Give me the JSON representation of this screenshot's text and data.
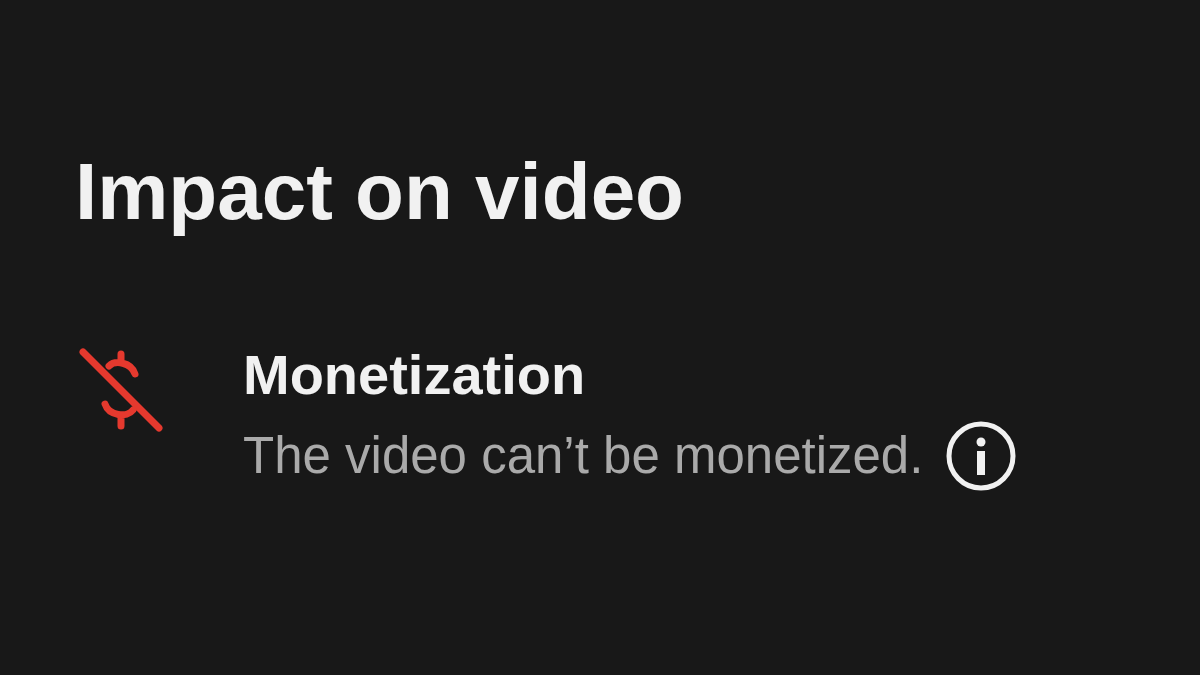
{
  "section": {
    "title": "Impact on video"
  },
  "items": [
    {
      "title": "Monetization",
      "description": "The video can’t be monetized."
    }
  ]
}
